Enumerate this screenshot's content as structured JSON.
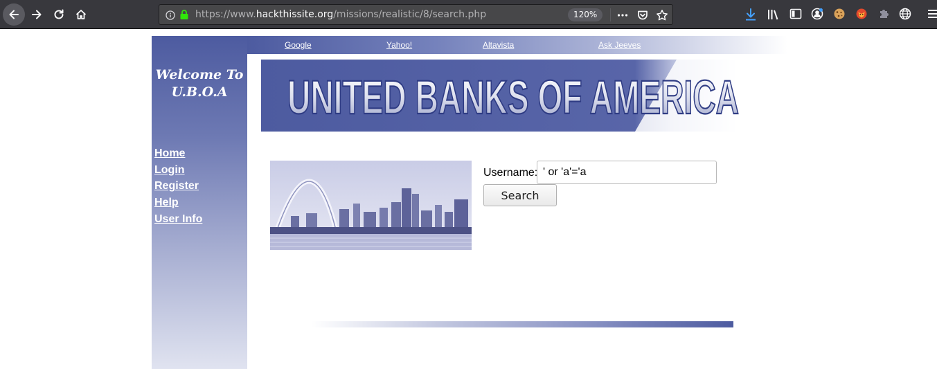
{
  "browser": {
    "url_prefix": "https://www.",
    "url_domain": "hackthissite.org",
    "url_path": "/missions/realistic/8/search.php",
    "zoom": "120%"
  },
  "topnav": {
    "links": [
      "Google",
      "Yahoo!",
      "Altavista",
      "Ask Jeeves"
    ]
  },
  "sidebar": {
    "welcome_line1": "Welcome To",
    "welcome_line2": "U.B.O.A",
    "items": [
      "Home",
      "Login",
      "Register",
      "Help",
      "User Info"
    ]
  },
  "banner": {
    "title": "UNITED BANKS OF AMERICA"
  },
  "search": {
    "label": "Username:",
    "value": "' or 'a'='a",
    "button": "Search"
  },
  "colors": {
    "brand_blue": "#4d5ba0",
    "chrome_dark": "#38383d"
  }
}
